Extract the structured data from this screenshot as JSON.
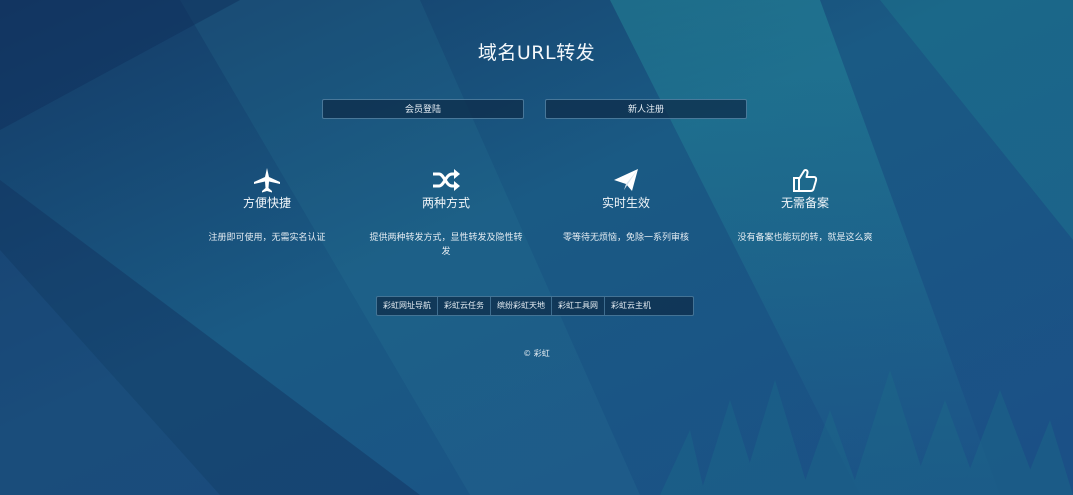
{
  "page": {
    "title": "域名URL转发"
  },
  "auth": {
    "login_label": "会员登陆",
    "register_label": "新人注册"
  },
  "features": [
    {
      "icon": "airplane-icon",
      "title": "方便快捷",
      "desc": "注册即可使用，无需实名认证"
    },
    {
      "icon": "shuffle-icon",
      "title": "两种方式",
      "desc": "提供两种转发方式，显性转发及隐性转发"
    },
    {
      "icon": "paper-plane-icon",
      "title": "实时生效",
      "desc": "零等待无烦恼，免除一系列审核"
    },
    {
      "icon": "thumbs-up-icon",
      "title": "无需备案",
      "desc": "没有备案也能玩的转，就是这么爽"
    }
  ],
  "links": [
    {
      "label": "彩虹网址导航"
    },
    {
      "label": "彩虹云任务"
    },
    {
      "label": "缤纷彩虹天地"
    },
    {
      "label": "彩虹工具网"
    },
    {
      "label": "彩虹云主机"
    }
  ],
  "footer": {
    "text": "© 彩虹"
  },
  "colors": {
    "bg_dark": "#173f6c",
    "bg_light": "#1a7a8c",
    "button_bg": "#0e2c4a",
    "button_border": "#78afd2",
    "text": "#ffffff"
  }
}
